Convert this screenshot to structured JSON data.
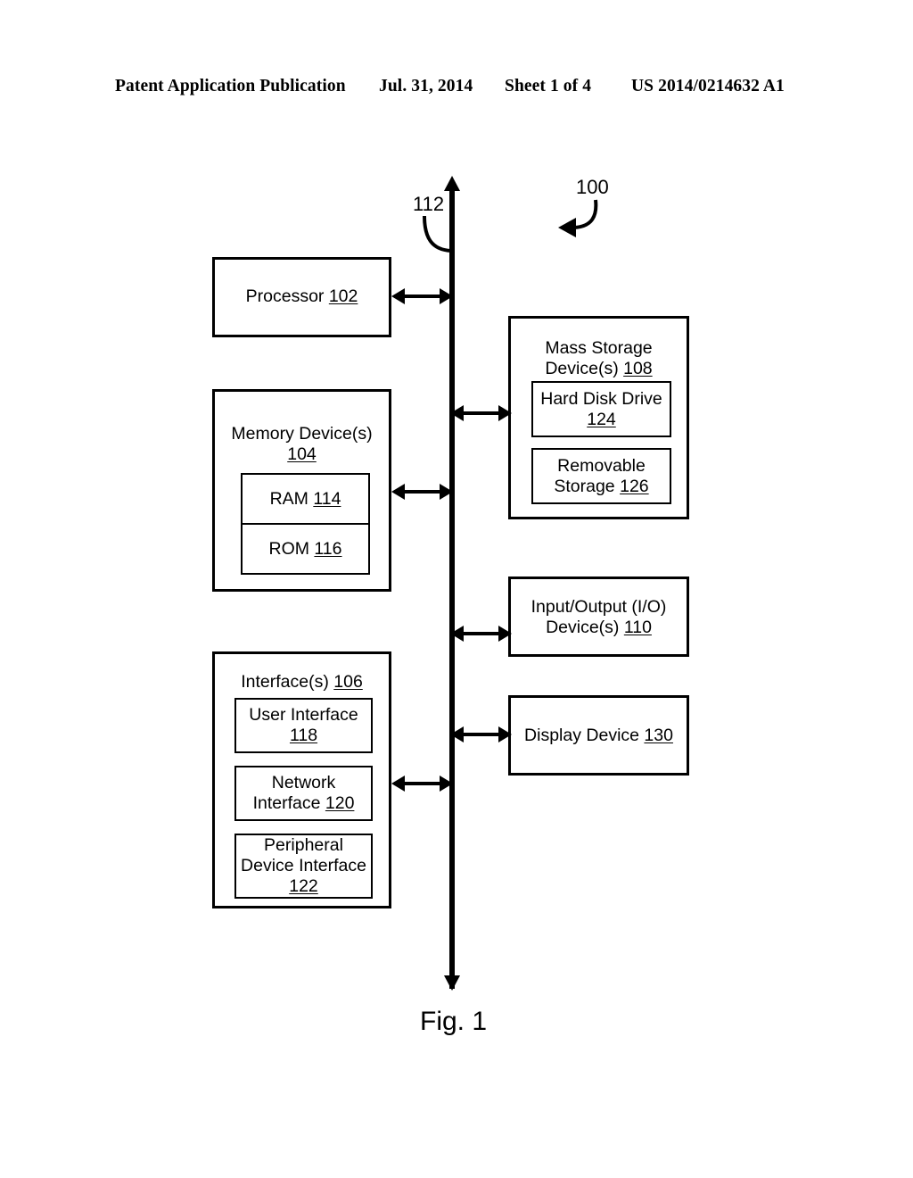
{
  "header": {
    "publication": "Patent Application Publication",
    "date": "Jul. 31, 2014",
    "sheet": "Sheet 1 of 4",
    "patent_number": "US 2014/0214632 A1"
  },
  "figure": {
    "caption": "Fig. 1",
    "system_ref": "100",
    "bus_ref": "112",
    "left_column": [
      {
        "title": "Processor",
        "ref": "102",
        "children": []
      },
      {
        "title": "Memory Device(s)",
        "ref": "104",
        "children": [
          {
            "label": "RAM",
            "ref": "114"
          },
          {
            "label": "ROM",
            "ref": "116"
          }
        ]
      },
      {
        "title": "Interface(s)",
        "ref": "106",
        "children": [
          {
            "label": "User Interface",
            "ref": "118"
          },
          {
            "label": "Network Interface",
            "ref": "120"
          },
          {
            "label": "Peripheral Device Interface",
            "ref": "122"
          }
        ]
      }
    ],
    "right_column": [
      {
        "title": "Mass Storage Device(s)",
        "ref": "108",
        "children": [
          {
            "label": "Hard Disk Drive",
            "ref": "124"
          },
          {
            "label": "Removable Storage",
            "ref": "126"
          }
        ]
      },
      {
        "title": "Input/Output (I/O) Device(s)",
        "ref": "110",
        "children": []
      },
      {
        "title": "Display Device",
        "ref": "130",
        "children": []
      }
    ],
    "colors": {
      "ink": "#000000",
      "paper": "#ffffff"
    }
  }
}
